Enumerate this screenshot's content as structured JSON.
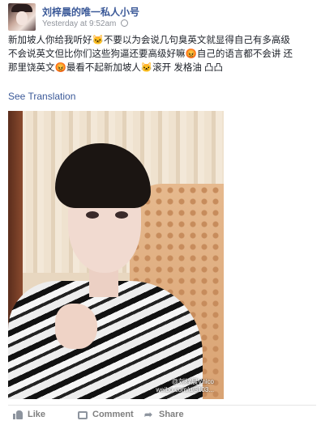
{
  "post": {
    "author": "刘梓晨的唯一私人小号",
    "timestamp": "Yesterday at 9:52am",
    "text_lines": [
      "新加坡人你给我听好🐱不要以为会说几句臭英文就显得自己有多高级",
      "不会说英文但比你们这些狗逼还要高级好嘛😡自己的语言都不会讲 还",
      "那里饶英文😡最看不起新加坡人🐱滚开 发格油 凸凸"
    ],
    "see_translation": "See Translation",
    "photo_watermark_line1": "@刘梓晨Vnico",
    "photo_watermark_line2": "weibo.com/u/5103..."
  },
  "actions": {
    "like": "Like",
    "comment": "Comment",
    "share": "Share"
  },
  "icons": {
    "globe": "globe-icon",
    "like": "thumbs-up-icon",
    "comment": "comment-icon",
    "share": "share-arrow-icon"
  },
  "colors": {
    "link": "#3b5998",
    "meta": "#90949c",
    "action": "#7f7f7f"
  }
}
